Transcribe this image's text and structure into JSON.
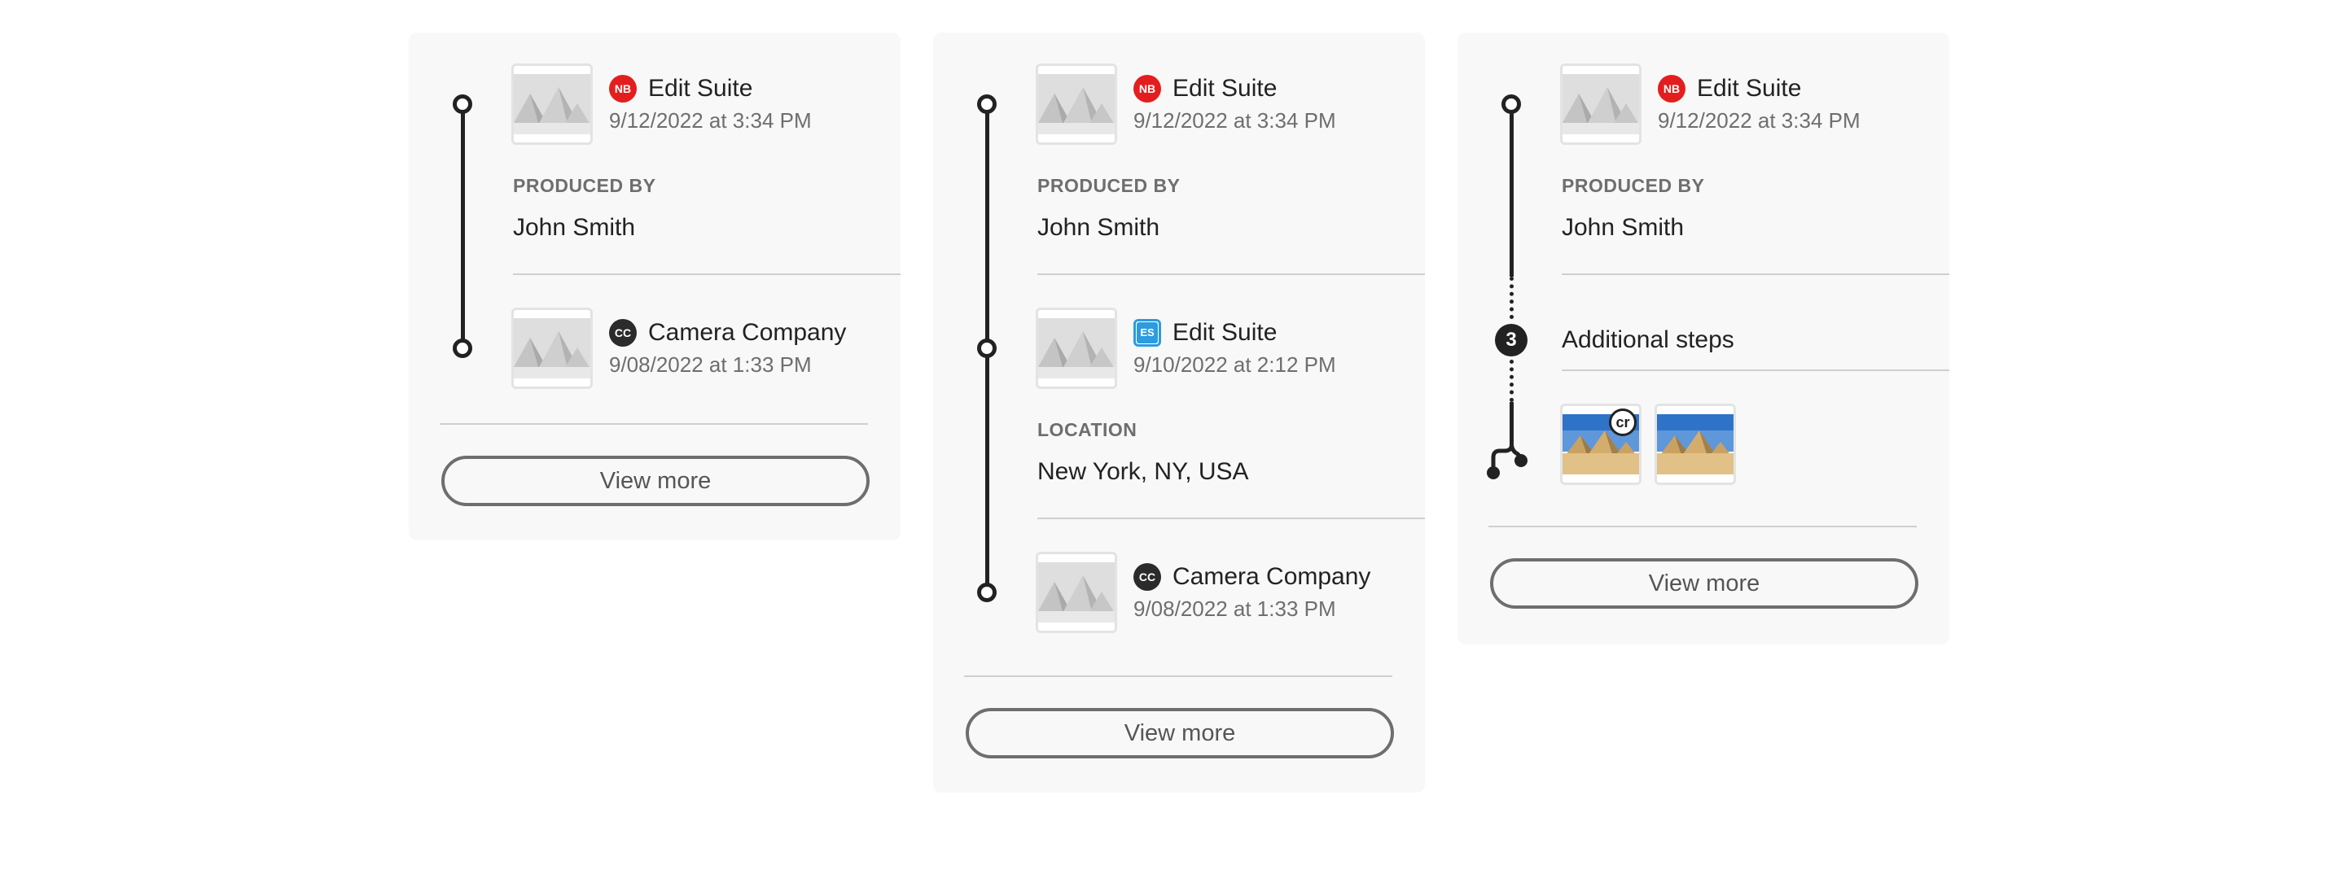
{
  "colors": {
    "card_bg": "#f8f8f8",
    "timeline": "#222222",
    "nb_badge": "#e41e1e",
    "es_badge": "#2c9be0",
    "muted_text": "#6e6e6e"
  },
  "cards": [
    {
      "entries": [
        {
          "logo": "NB",
          "logo_icon": "nb-logo-icon",
          "app": "Edit Suite",
          "date": "9/12/2022 at 3:34 PM"
        },
        {
          "logo": "CC",
          "logo_icon": "cc-logo-icon",
          "app": "Camera Company",
          "date": "9/08/2022 at 1:33 PM"
        }
      ],
      "details": [
        {
          "label": "PRODUCED BY",
          "value": "John Smith"
        }
      ],
      "view_more": "View more"
    },
    {
      "entries": [
        {
          "logo": "NB",
          "logo_icon": "nb-logo-icon",
          "app": "Edit Suite",
          "date": "9/12/2022 at 3:34 PM"
        },
        {
          "logo": "ES",
          "logo_icon": "es-logo-icon",
          "app": "Edit Suite",
          "date": "9/10/2022 at 2:12 PM"
        },
        {
          "logo": "CC",
          "logo_icon": "cc-logo-icon",
          "app": "Camera Company",
          "date": "9/08/2022 at 1:33 PM"
        }
      ],
      "details": [
        {
          "label": "PRODUCED BY",
          "value": "John Smith"
        },
        {
          "label": "LOCATION",
          "value": "New York, NY, USA"
        }
      ],
      "view_more": "View more"
    },
    {
      "entries": [
        {
          "logo": "NB",
          "logo_icon": "nb-logo-icon",
          "app": "Edit Suite",
          "date": "9/12/2022 at 3:34 PM"
        }
      ],
      "details": [
        {
          "label": "PRODUCED BY",
          "value": "John Smith"
        }
      ],
      "additional_steps": {
        "count": "3",
        "label": "Additional steps"
      },
      "ingredients": {
        "badge": "cr",
        "items": [
          "pyramids-photo",
          "pyramids-photo"
        ]
      },
      "view_more": "View more"
    }
  ]
}
